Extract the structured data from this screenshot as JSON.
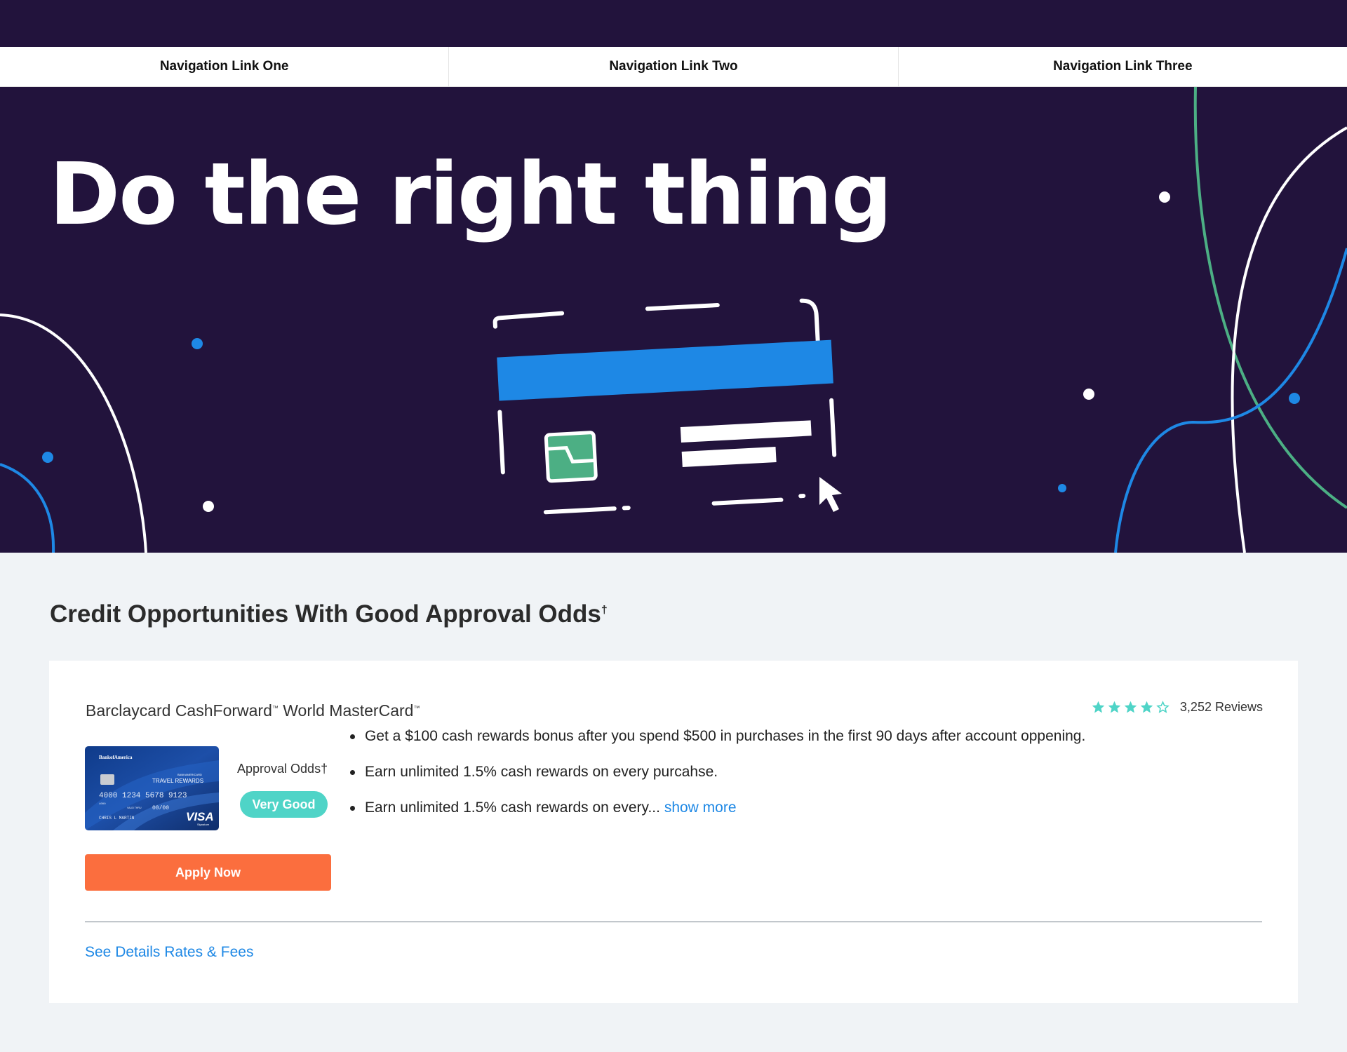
{
  "nav": {
    "links": [
      {
        "label": "Navigation Link One"
      },
      {
        "label": "Navigation Link Two"
      },
      {
        "label": "Navigation Link Three"
      }
    ]
  },
  "hero": {
    "title": "Do the right thing"
  },
  "section": {
    "title": "Credit Opportunities With Good Approval Odds",
    "title_mark": "†"
  },
  "offer": {
    "card_name_part1": "Barclaycard CashForward",
    "card_name_part2": " World MasterCard",
    "tm": "™",
    "rating": {
      "stars": 4,
      "max": 5,
      "reviews": "3,252 Reviews"
    },
    "card_image": {
      "bank": "BankofAmerica",
      "product_small": "BANKAMERICARD",
      "product": "TRAVEL REWARDS",
      "number": "4000 1234 5678 9123",
      "number_prefix": "4000",
      "valid_label": "VALID THRU",
      "expiry": "00/00",
      "holder": "CHRIS L MARTIN",
      "network": "VISA",
      "network_sub": "Signature"
    },
    "approval_odds_label": "Approval Odds†",
    "approval_odds_value": "Very Good",
    "apply_label": "Apply Now",
    "bullets": [
      "Get a $100 cash rewards bonus after you spend $500 in purchases in the first 90 days after account oppening.",
      "Earn unlimited 1.5% cash rewards on every purcahse.",
      "Earn unlimited 1.5% cash rewards on every..."
    ],
    "show_more": "show more",
    "details_link": "See Details Rates & Fees"
  },
  "colors": {
    "hero_bg": "#22133c",
    "accent_blue": "#1e88e5",
    "accent_orange": "#fb6e3e",
    "teal": "#4fd4c7",
    "green": "#4caf84",
    "page_bg": "#f0f3f6"
  },
  "icons": [
    "star-icon",
    "credit-card-illustration",
    "cursor-icon"
  ]
}
